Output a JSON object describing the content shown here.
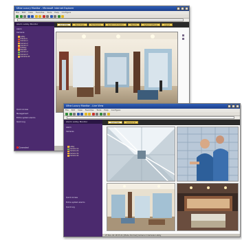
{
  "back_window": {
    "title": "Ultra Luxury Monitor - Microsoft Internet Explorer",
    "menu": [
      "File",
      "Edit",
      "View",
      "Favorites",
      "Tools",
      "Help",
      "Configure"
    ],
    "sidebar": {
      "header": "Alarm Lobby Monitor",
      "top_items": [
        "Alarm",
        "Cameras"
      ],
      "tree": [
        "Lobby",
        "Entrance",
        "Camera 1",
        "Camera 2",
        "Camera 3",
        "Hallway",
        "Elevator",
        "Camera 4",
        "Camera 5",
        "Cameras All"
      ],
      "bottom_items": [
        "Quick Access",
        "Management",
        "Entire system alarms",
        "Quick Log"
      ],
      "status": "Connected"
    },
    "tabs": [
      "Live Video",
      "Recordings",
      "Permissions",
      "System Information",
      "Reports",
      "System Settings",
      "Logout"
    ],
    "footer": ""
  },
  "front_window": {
    "title": "Ultra Luxury Monitor - Live View",
    "menu": [
      "File",
      "Edit",
      "View",
      "Favorites",
      "Tools",
      "Help",
      "Configure"
    ],
    "sidebar": {
      "header": "Alarm Lobby Monitor",
      "top_items": [
        "Alarm",
        "Cameras"
      ],
      "tree": [
        "Lobby",
        "Camera 1A",
        "Camera 2A",
        "Camera 3A",
        "Camera 4A"
      ],
      "bottom_items": [
        "Quick Access",
        "Entire system alarms",
        "Quick Log"
      ]
    },
    "tabs": [
      "Quad View",
      "Camera All"
    ],
    "footer": "27 Nov 04 18:55:21  [Mode: Normal]  Camera 4 Cameras Lobby"
  },
  "colors": {
    "sidebar": "#4b2a6e",
    "title_bar": "#1d3f8a",
    "tab": "#f3d463"
  },
  "icons": [
    "window-controls-icon",
    "toolbar-icons",
    "folder-icon",
    "camera-icon"
  ]
}
